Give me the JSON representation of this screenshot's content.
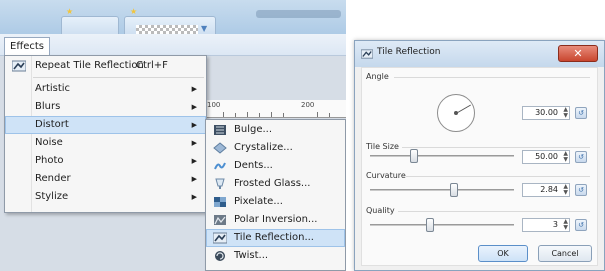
{
  "app": {
    "menubar": {
      "effects_label": "Effects"
    },
    "effects_menu": {
      "repeat": {
        "label": "Repeat Tile Reflection",
        "shortcut": "Ctrl+F"
      },
      "items": [
        {
          "label": "Artistic"
        },
        {
          "label": "Blurs"
        },
        {
          "label": "Distort"
        },
        {
          "label": "Noise"
        },
        {
          "label": "Photo"
        },
        {
          "label": "Render"
        },
        {
          "label": "Stylize"
        }
      ]
    },
    "ruler": {
      "labels": [
        "100",
        "200"
      ]
    },
    "distort_menu": {
      "items": [
        {
          "label": "Bulge...",
          "icon": "bulge-icon"
        },
        {
          "label": "Crystalize...",
          "icon": "crystalize-icon"
        },
        {
          "label": "Dents...",
          "icon": "dents-icon"
        },
        {
          "label": "Frosted Glass...",
          "icon": "frosted-glass-icon"
        },
        {
          "label": "Pixelate...",
          "icon": "pixelate-icon"
        },
        {
          "label": "Polar Inversion...",
          "icon": "polar-inversion-icon"
        },
        {
          "label": "Tile Reflection...",
          "icon": "tile-reflection-icon"
        },
        {
          "label": "Twist...",
          "icon": "twist-icon"
        }
      ]
    }
  },
  "dialog": {
    "title": "Tile Reflection",
    "close_symbol": "✕",
    "angle": {
      "label": "Angle",
      "value": "30.00"
    },
    "tile_size": {
      "label": "Tile Size",
      "value": "50.00"
    },
    "curvature": {
      "label": "Curvature",
      "value": "2.84"
    },
    "quality": {
      "label": "Quality",
      "value": "3"
    },
    "ok_label": "OK",
    "cancel_label": "Cancel"
  },
  "colors": {
    "highlight": "#cfe3f7",
    "title_bar": "#c5d8ec",
    "close": "#c9462f"
  }
}
